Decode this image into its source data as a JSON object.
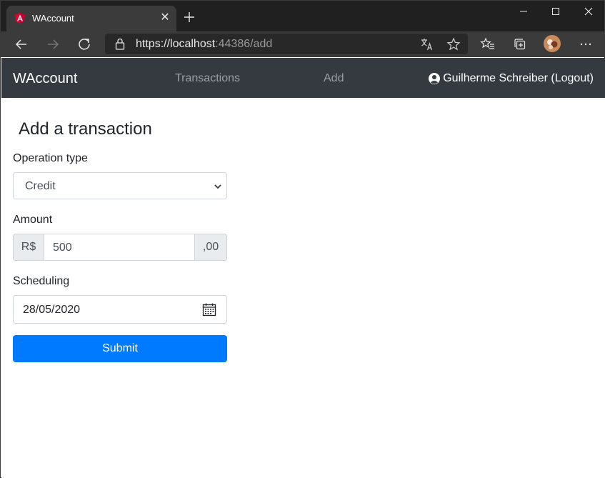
{
  "browser": {
    "tab_title": "WAccount",
    "url_main": "https://localhost",
    "url_rest": ":44386/add"
  },
  "navbar": {
    "brand": "WAccount",
    "links": [
      "Transactions",
      "Add"
    ],
    "user": "Guilherme Schreiber (Logout)"
  },
  "form": {
    "title": "Add a transaction",
    "operation_label": "Operation type",
    "operation_value": "Credit",
    "amount_label": "Amount",
    "amount_prefix": "R$",
    "amount_value": "500",
    "amount_suffix": ",00",
    "scheduling_label": "Scheduling",
    "scheduling_value": "28/05/2020",
    "submit_label": "Submit"
  },
  "colors": {
    "navbar": "#343a40",
    "primary": "#007bff"
  }
}
